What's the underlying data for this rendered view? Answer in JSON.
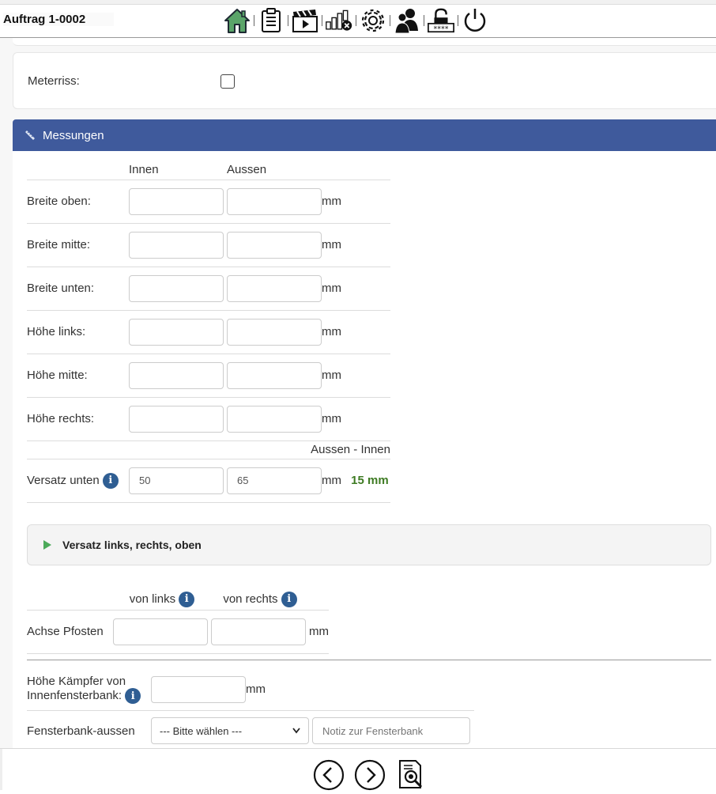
{
  "header": {
    "order_title": "Auftrag 1-0002",
    "icons": [
      "home-icon",
      "clipboard-icon",
      "clapperboard-icon",
      "chart-delete-icon",
      "gear-icon",
      "users-icon",
      "lock-password-icon",
      "power-icon"
    ]
  },
  "meterriss": {
    "label": "Meterriss:",
    "checked": false
  },
  "measurements": {
    "title": "Messungen",
    "col_inner": "Innen",
    "col_outer": "Aussen",
    "unit": "mm",
    "rows": [
      {
        "label": "Breite oben:",
        "inner": "",
        "outer": ""
      },
      {
        "label": "Breite mitte:",
        "inner": "",
        "outer": ""
      },
      {
        "label": "Breite unten:",
        "inner": "",
        "outer": ""
      },
      {
        "label": "Höhe links:",
        "inner": "",
        "outer": ""
      },
      {
        "label": "Höhe mitte:",
        "inner": "",
        "outer": ""
      },
      {
        "label": "Höhe rechts:",
        "inner": "",
        "outer": ""
      }
    ],
    "diff_header": "Aussen - Innen",
    "offset_bottom": {
      "label": "Versatz unten",
      "inner": "50",
      "outer": "65",
      "diff": "15 mm"
    }
  },
  "collapsible": {
    "label": "Versatz links, rechts, oben",
    "expanded": false
  },
  "post_axis": {
    "col_left": "von links",
    "col_right": "von rechts",
    "label": "Achse Pfosten",
    "left": "",
    "right": "",
    "unit": "mm"
  },
  "transom": {
    "label_line1": "Höhe Kämpfer von",
    "label_line2": "Innenfensterbank:",
    "value": "",
    "unit": "mm"
  },
  "sill": {
    "label": "Fensterbank-aussen",
    "select_value": "--- Bitte wählen ---",
    "note_placeholder": "Notiz zur Fensterbank"
  },
  "colors": {
    "panel_header": "#3f5a9c",
    "info": "#2f5e93",
    "diff": "#3e7b23",
    "triangle": "#4caa5a"
  },
  "footer": {
    "icons": [
      "chevron-left-circle-icon",
      "chevron-right-circle-icon",
      "document-search-icon"
    ]
  }
}
